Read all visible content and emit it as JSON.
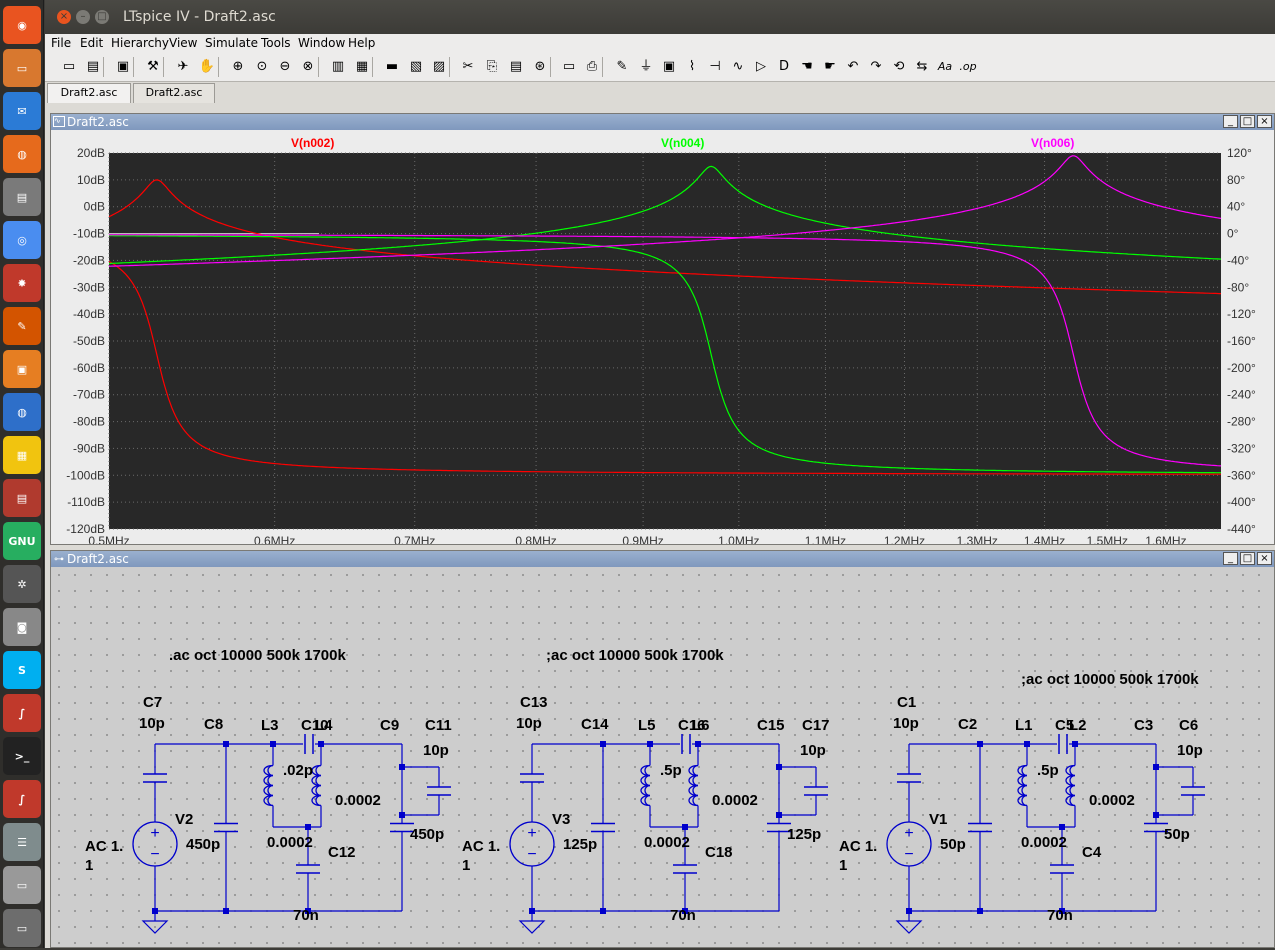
{
  "window": {
    "title": "LTspice IV - Draft2.asc",
    "close": "×",
    "minimize": "–",
    "maximize": "□"
  },
  "menu": [
    "File",
    "Edit",
    "Hierarchy",
    "View",
    "Simulate",
    "Tools",
    "Window",
    "Help"
  ],
  "tabs": [
    "Draft2.asc",
    "Draft2.asc"
  ],
  "plot_pane": {
    "title": "Draft2.asc",
    "min": "_",
    "restore": "□",
    "close": "×"
  },
  "schematic_pane": {
    "title": "Draft2.asc",
    "min": "_",
    "restore": "□",
    "close": "×"
  },
  "launcher_icons": [
    "ubuntu-dash-icon",
    "files-icon",
    "thunderbird-icon",
    "firefox-icon",
    "disk-usage-icon",
    "chrome-icon",
    "bug-icon",
    "settings-icon",
    "ubuntu-software-icon",
    "google-earth-icon",
    "spreadsheet-icon",
    "cards-game-icon",
    "gnu-icon",
    "gear-icon",
    "camera-icon",
    "skype-icon",
    "ltspice-icon",
    "terminal-icon",
    "ltspice-icon-2",
    "settings-manager-icon",
    "window-icon",
    "drive-icon"
  ],
  "launcher_gnu_label": "GNU",
  "colors": {
    "series_red": "#ff0000",
    "series_green": "#00ff00",
    "series_magenta": "#ff00ff",
    "plot_bg": "#282828",
    "wire": "#0000cc"
  },
  "chart_data": {
    "type": "line",
    "x_scale": "log",
    "x_range_hz": [
      500000,
      1700000
    ],
    "x_ticks": [
      "0.5MHz",
      "0.6MHz",
      "0.7MHz",
      "0.8MHz",
      "0.9MHz",
      "1.0MHz",
      "1.1MHz",
      "1.2MHz",
      "1.3MHz",
      "1.4MHz",
      "1.5MHz",
      "1.6MHz"
    ],
    "y_left_ticks": [
      "20dB",
      "10dB",
      "0dB",
      "-10dB",
      "-20dB",
      "-30dB",
      "-40dB",
      "-50dB",
      "-60dB",
      "-70dB",
      "-80dB",
      "-90dB",
      "-100dB",
      "-110dB",
      "-120dB"
    ],
    "y_left_range_db": [
      -120,
      20
    ],
    "y_right_ticks": [
      "120°",
      "80°",
      "40°",
      "0°",
      "-40°",
      "-80°",
      "-120°",
      "-160°",
      "-200°",
      "-240°",
      "-280°",
      "-320°",
      "-360°",
      "-400°",
      "-440°"
    ],
    "y_right_range_deg": [
      -440,
      120
    ],
    "grid": true,
    "series": [
      {
        "name": "V(n002)",
        "color": "#ff0000",
        "resonance_hz": 527000,
        "peak_db": 10
      },
      {
        "name": "V(n004)",
        "color": "#00ff00",
        "resonance_hz": 970000,
        "peak_db": 15
      },
      {
        "name": "V(n006)",
        "color": "#ff00ff",
        "resonance_hz": 1445000,
        "peak_db": 19
      }
    ]
  },
  "schematic": {
    "blocks": [
      {
        "directive": ".ac oct 10000 500k 1700k",
        "labels": {
          "cin": "C7",
          "cin_v": "10p",
          "cpar": "C8",
          "la": "L3",
          "cc": "C10",
          "lb": "L4",
          "cout": "C9",
          "cload": "C11",
          "cload_v": "10p",
          "cc_v": ".02p",
          "lb_v": "0.0002",
          "la_v": "0.0002",
          "cpar_v": "450p",
          "cout_v": "450p",
          "cbot": "C12",
          "cbot_v": "70n",
          "vsrc": "V2",
          "ac": "AC 1.",
          "ac2": "1"
        }
      },
      {
        "directive": ";ac oct 10000 500k 1700k",
        "labels": {
          "cin": "C13",
          "cin_v": "10p",
          "cpar": "C14",
          "la": "L5",
          "cc": "C16",
          "lb": "L6",
          "cout": "C15",
          "cload": "C17",
          "cload_v": "10p",
          "cc_v": ".5p",
          "lb_v": "0.0002",
          "la_v": "0.0002",
          "cpar_v": "125p",
          "cout_v": "125p",
          "cbot": "C18",
          "cbot_v": "70n",
          "vsrc": "V3",
          "ac": "AC 1.",
          "ac2": "1"
        }
      },
      {
        "directive": ";ac oct 10000 500k 1700k",
        "labels": {
          "cin": "C1",
          "cin_v": "10p",
          "cpar": "C2",
          "la": "L1",
          "cc": "C5",
          "lb": "L2",
          "cout": "C3",
          "cload": "C6",
          "cload_v": "10p",
          "cc_v": ".5p",
          "lb_v": "0.0002",
          "la_v": "0.0002",
          "cpar_v": "50p",
          "cout_v": "50p",
          "cbot": "C4",
          "cbot_v": "70n",
          "vsrc": "V1",
          "ac": "AC 1.",
          "ac2": "1"
        }
      }
    ]
  }
}
